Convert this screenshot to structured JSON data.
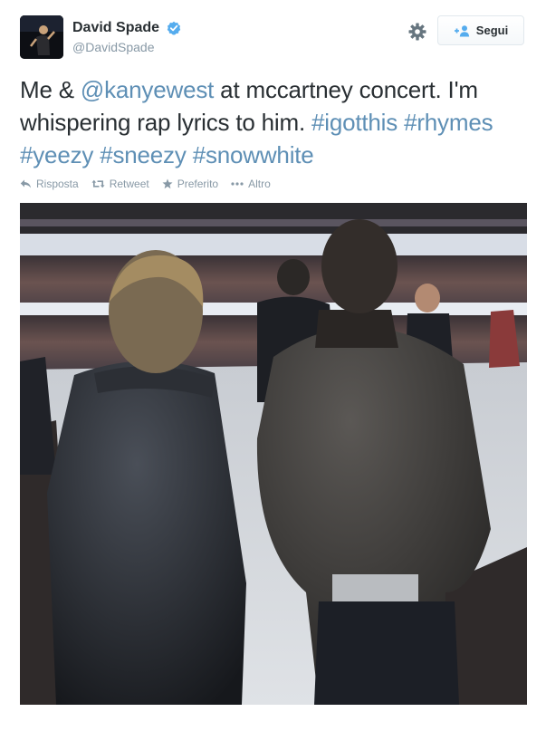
{
  "author": {
    "name": "David Spade",
    "handle": "@DavidSpade",
    "verified": true,
    "avatar_icon": "avatar-photo"
  },
  "header": {
    "settings_icon": "gear-icon",
    "follow_label": "Segui",
    "follow_icon": "add-user-icon"
  },
  "tweet": {
    "segments": [
      {
        "type": "text",
        "value": "Me & "
      },
      {
        "type": "mention",
        "value": "@kanyewest"
      },
      {
        "type": "text",
        "value": " at mccartney concert. I'm whispering rap lyrics to him. "
      },
      {
        "type": "hashtag",
        "value": "#igotthis"
      },
      {
        "type": "text",
        "value": " "
      },
      {
        "type": "hashtag",
        "value": "#rhymes"
      },
      {
        "type": "text",
        "value": " "
      },
      {
        "type": "hashtag",
        "value": "#yeezy"
      },
      {
        "type": "text",
        "value": " "
      },
      {
        "type": "hashtag",
        "value": "#sneezy"
      },
      {
        "type": "text",
        "value": " "
      },
      {
        "type": "hashtag",
        "value": "#snowwhite"
      }
    ]
  },
  "actions": {
    "reply": "Risposta",
    "retweet": "Retweet",
    "favorite": "Preferito",
    "more": "Altro"
  },
  "colors": {
    "text": "#292f33",
    "muted": "#8899a6",
    "link": "#5e8fb5",
    "verified": "#55acee"
  }
}
